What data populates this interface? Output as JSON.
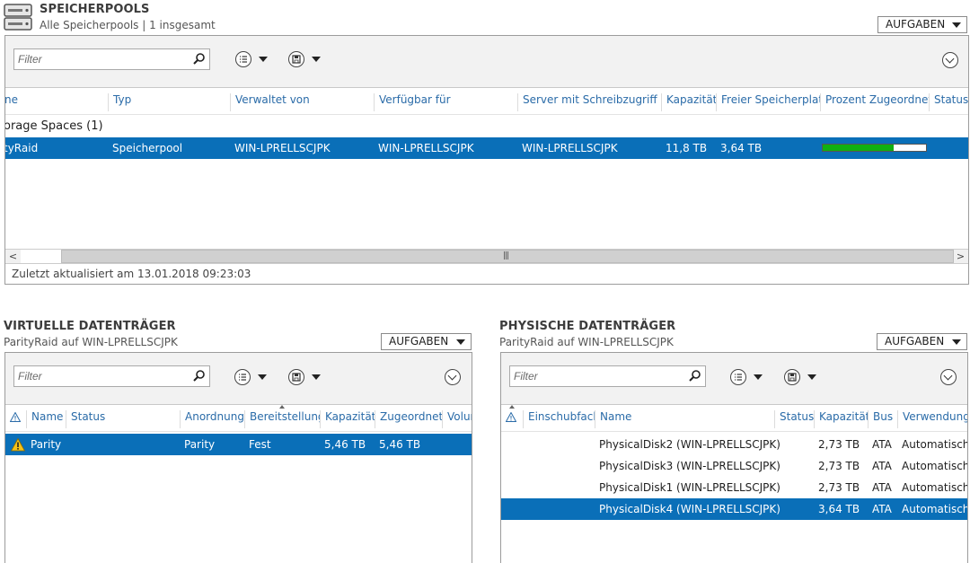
{
  "pools": {
    "title": "SPEICHERPOOLS",
    "subtitle": "Alle Speicherpools | 1 insgesamt",
    "tasks_label": "AUFGABEN",
    "filter_placeholder": "Filter",
    "columns": [
      "ne",
      "Typ",
      "Verwaltet von",
      "Verfügbar für",
      "Server mit Schreibzugriff",
      "Kapazität",
      "Freier Speicherplatz",
      "Prozent Zugeordnet",
      "Status"
    ],
    "group_label": "orage Spaces (1)",
    "row": {
      "name": "tyRaid",
      "type": "Speicherpool",
      "managed_by": "WIN-LPRELLSCJPK",
      "available_to": "WIN-LPRELLSCJPK",
      "rw_server": "WIN-LPRELLSCJPK",
      "capacity": "11,8 TB",
      "free": "3,64 TB",
      "percent_allocated": 0.69
    },
    "last_updated": "Zuletzt aktualisiert am 13.01.2018 09:23:03"
  },
  "virtual": {
    "title": "VIRTUELLE DATENTRÄGER",
    "subtitle": "ParityRaid auf WIN-LPRELLSCJPK",
    "tasks_label": "AUFGABEN",
    "filter_placeholder": "Filter",
    "columns": [
      "Name",
      "Status",
      "Anordnung",
      "Bereitstellung",
      "Kapazität",
      "Zugeordnet",
      "Volum"
    ],
    "rows": [
      {
        "name": "Parity",
        "status": "",
        "layout": "Parity",
        "provisioning": "Fest",
        "capacity": "5,46 TB",
        "allocated": "5,46 TB"
      }
    ]
  },
  "physical": {
    "title": "PHYSISCHE DATENTRÄGER",
    "subtitle": "ParityRaid auf WIN-LPRELLSCJPK",
    "tasks_label": "AUFGABEN",
    "filter_placeholder": "Filter",
    "columns": [
      "Einschubfach",
      "Name",
      "Status",
      "Kapazität",
      "Bus",
      "Verwendung"
    ],
    "rows": [
      {
        "name": "PhysicalDisk2 (WIN-LPRELLSCJPK)",
        "capacity": "2,73 TB",
        "bus": "ATA",
        "usage": "Automatisch"
      },
      {
        "name": "PhysicalDisk3 (WIN-LPRELLSCJPK)",
        "capacity": "2,73 TB",
        "bus": "ATA",
        "usage": "Automatisch"
      },
      {
        "name": "PhysicalDisk1 (WIN-LPRELLSCJPK)",
        "capacity": "2,73 TB",
        "bus": "ATA",
        "usage": "Automatisch"
      },
      {
        "name": "PhysicalDisk4 (WIN-LPRELLSCJPK)",
        "capacity": "3,64 TB",
        "bus": "ATA",
        "usage": "Automatisch"
      }
    ]
  },
  "colors": {
    "selection": "#0a6fb8",
    "header_text": "#2a6ba8",
    "progress": "#10b010"
  }
}
